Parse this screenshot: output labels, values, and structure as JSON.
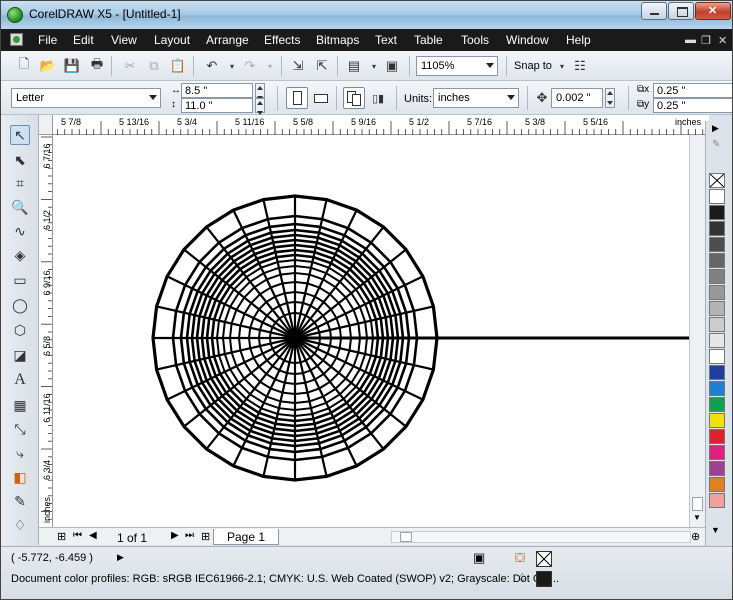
{
  "window": {
    "title": "CorelDRAW X5 - [Untitled-1]"
  },
  "menu": [
    "File",
    "Edit",
    "View",
    "Layout",
    "Arrange",
    "Effects",
    "Bitmaps",
    "Text",
    "Table",
    "Tools",
    "Window",
    "Help"
  ],
  "standard_toolbar": {
    "zoom_level": "1105%",
    "snap_to_label": "Snap to"
  },
  "property_bar": {
    "page_size": "Letter",
    "page_width": "8.5 \"",
    "page_height": "11.0 \"",
    "units_label": "Units:",
    "units_value": "inches",
    "nudge_distance": "0.002 \"",
    "duplicate_x": "0.25 \"",
    "duplicate_y": "0.25 \""
  },
  "ruler": {
    "horizontal_labels": [
      "5 7/8",
      "5 13/16",
      "5 3/4",
      "5 11/16",
      "5 5/8",
      "5 9/16",
      "5 1/2",
      "5 7/16",
      "5 3/8",
      "5 5/16",
      "inches"
    ],
    "vertical_labels": [
      "6 7/16",
      "6 1/2",
      "6 9/16",
      "6 5/8",
      "6 11/16",
      "6 3/4",
      "inches"
    ]
  },
  "page_nav": {
    "counter": "1 of 1",
    "tab_label": "Page 1"
  },
  "status": {
    "cursor_position": "( -5.772, -6.459 )",
    "color_profiles": "Document color profiles: RGB: sRGB IEC61966-2.1; CMYK: U.S. Web Coated (SWOP) v2; Grayscale: Dot Gai..."
  },
  "palette_colors": [
    "#ffffff",
    "#1a1a1a",
    "#333333",
    "#4d4d4d",
    "#666666",
    "#808080",
    "#999999",
    "#b3b3b3",
    "#cccccc",
    "#e6e6e6",
    "#ffffff",
    "#1f3fa0",
    "#1f7fd0",
    "#11a050",
    "#f0e010",
    "#e02030",
    "#e0207f",
    "#a04090",
    "#e08020",
    "#f0a0a0"
  ]
}
